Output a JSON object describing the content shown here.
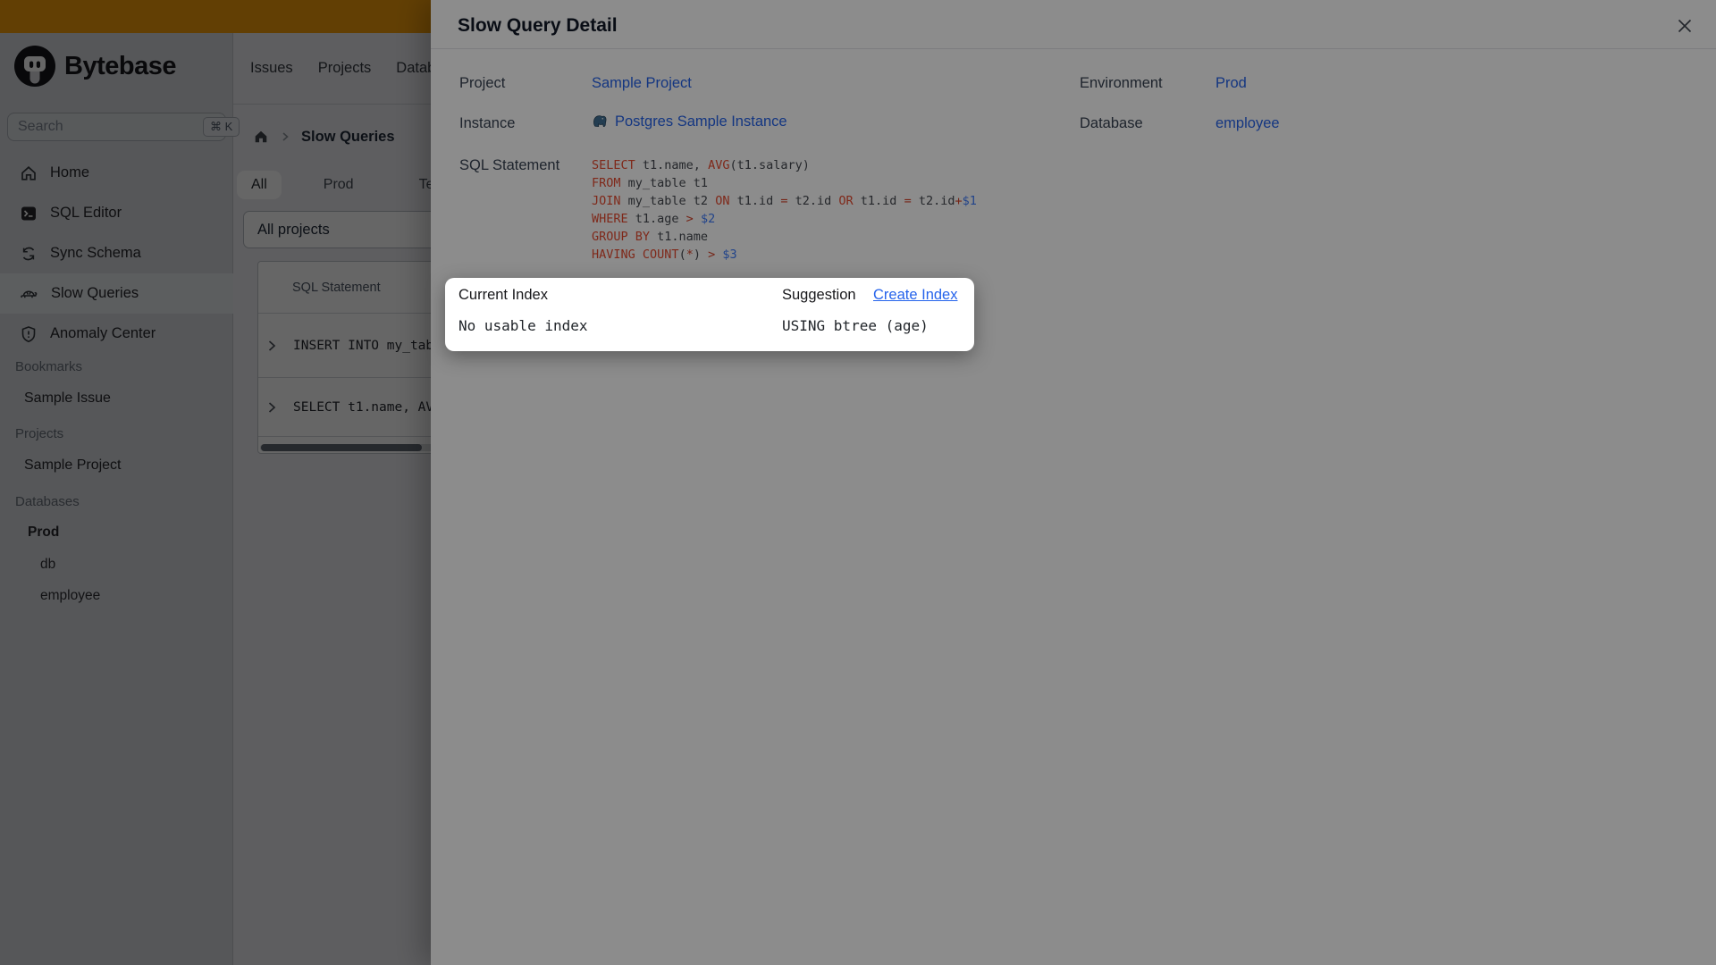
{
  "colors": {
    "link": "#2563eb",
    "banner": "#f59e0b"
  },
  "brand": {
    "name": "Bytebase"
  },
  "search": {
    "placeholder": "Search",
    "shortcut": "⌘ K"
  },
  "top_nav": {
    "items": [
      "Issues",
      "Projects",
      "Databases"
    ]
  },
  "sidebar": {
    "nav": [
      {
        "label": "Home",
        "icon": "home-icon"
      },
      {
        "label": "SQL Editor",
        "icon": "terminal-icon"
      },
      {
        "label": "Sync Schema",
        "icon": "sync-icon"
      },
      {
        "label": "Slow Queries",
        "icon": "turtle-icon",
        "active": true
      },
      {
        "label": "Anomaly Center",
        "icon": "shield-icon"
      }
    ],
    "sections": [
      {
        "label": "Bookmarks",
        "items": [
          "Sample Issue"
        ]
      },
      {
        "label": "Projects",
        "items": [
          "Sample Project"
        ]
      },
      {
        "label": "Databases",
        "items": [
          "Prod",
          "db",
          "employee"
        ]
      }
    ]
  },
  "content": {
    "breadcrumb": {
      "current": "Slow Queries"
    },
    "env_tabs": {
      "items": [
        "All",
        "Prod",
        "Test"
      ],
      "active": "All"
    },
    "project_filter": {
      "value": "All projects"
    },
    "table": {
      "header": "SQL Statement",
      "rows": [
        "INSERT INTO my_tab",
        "SELECT t1.name, AV"
      ]
    }
  },
  "modal": {
    "title": "Slow Query Detail",
    "fields": {
      "project": {
        "label": "Project",
        "value": "Sample Project"
      },
      "environment": {
        "label": "Environment",
        "value": "Prod"
      },
      "instance": {
        "label": "Instance",
        "value": "Postgres Sample Instance"
      },
      "database": {
        "label": "Database",
        "value": "employee"
      },
      "sql": {
        "label": "SQL Statement"
      }
    },
    "sql_colors": {
      "k": "#e64a30",
      "o": "#d4432a",
      "v": "#3e7bfa",
      "p": "#43474e"
    },
    "sql_lines": [
      [
        [
          "SELECT",
          "k"
        ],
        [
          " t1.name, ",
          "p"
        ],
        [
          "AVG",
          "k"
        ],
        [
          "(t1.salary)",
          "p"
        ]
      ],
      [
        [
          "FROM",
          "k"
        ],
        [
          " my_table t1",
          "p"
        ]
      ],
      [
        [
          "JOIN",
          "k"
        ],
        [
          " my_table t2 ",
          "p"
        ],
        [
          "ON",
          "k"
        ],
        [
          " t1.id ",
          "p"
        ],
        [
          "=",
          "o"
        ],
        [
          " t2.id ",
          "p"
        ],
        [
          "OR",
          "k"
        ],
        [
          " t1.id ",
          "p"
        ],
        [
          "=",
          "o"
        ],
        [
          " t2.id",
          "p"
        ],
        [
          "+",
          "o"
        ],
        [
          "$1",
          "v"
        ]
      ],
      [
        [
          "WHERE",
          "k"
        ],
        [
          " t1.age ",
          "p"
        ],
        [
          ">",
          "o"
        ],
        [
          " ",
          "p"
        ],
        [
          "$2",
          "v"
        ]
      ],
      [
        [
          "GROUP BY",
          "k"
        ],
        [
          " t1.name",
          "p"
        ]
      ],
      [
        [
          "HAVING",
          "k"
        ],
        [
          " ",
          "p"
        ],
        [
          "COUNT",
          "k"
        ],
        [
          "(",
          "p"
        ],
        [
          "*",
          "o"
        ],
        [
          ")",
          "p"
        ],
        [
          " ",
          "p"
        ],
        [
          ">",
          "o"
        ],
        [
          " ",
          "p"
        ],
        [
          "$3",
          "v"
        ]
      ]
    ]
  },
  "popup": {
    "current": {
      "label": "Current Index",
      "value": "No usable index"
    },
    "suggestion": {
      "label": "Suggestion",
      "link": "Create Index",
      "value": "USING btree (age)"
    }
  }
}
